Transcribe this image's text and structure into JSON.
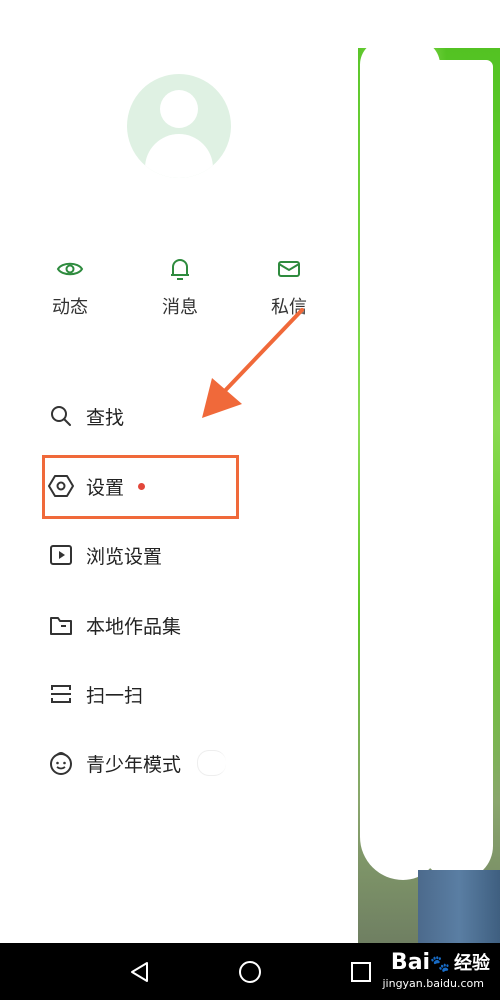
{
  "colors": {
    "accent": "#2e8b3e",
    "highlight": "#f0693a",
    "badge": "#e2473a"
  },
  "top_actions": [
    {
      "label": "动态",
      "icon": "eye-icon"
    },
    {
      "label": "消息",
      "icon": "bell-icon"
    },
    {
      "label": "私信",
      "icon": "mail-icon"
    }
  ],
  "menu": [
    {
      "label": "查找",
      "icon": "search-icon"
    },
    {
      "label": "设置",
      "icon": "settings-hex-icon",
      "badge": "red-dot"
    },
    {
      "label": "浏览设置",
      "icon": "play-box-icon"
    },
    {
      "label": "本地作品集",
      "icon": "folder-icon"
    },
    {
      "label": "扫一扫",
      "icon": "scan-icon"
    },
    {
      "label": "青少年模式",
      "icon": "kid-face-icon"
    }
  ],
  "navbar": {
    "buttons": [
      "back-icon",
      "home-icon",
      "recents-icon"
    ]
  },
  "watermark": {
    "brand": "Bai",
    "brand2": "经验",
    "url": "jingyan.baidu.com"
  }
}
